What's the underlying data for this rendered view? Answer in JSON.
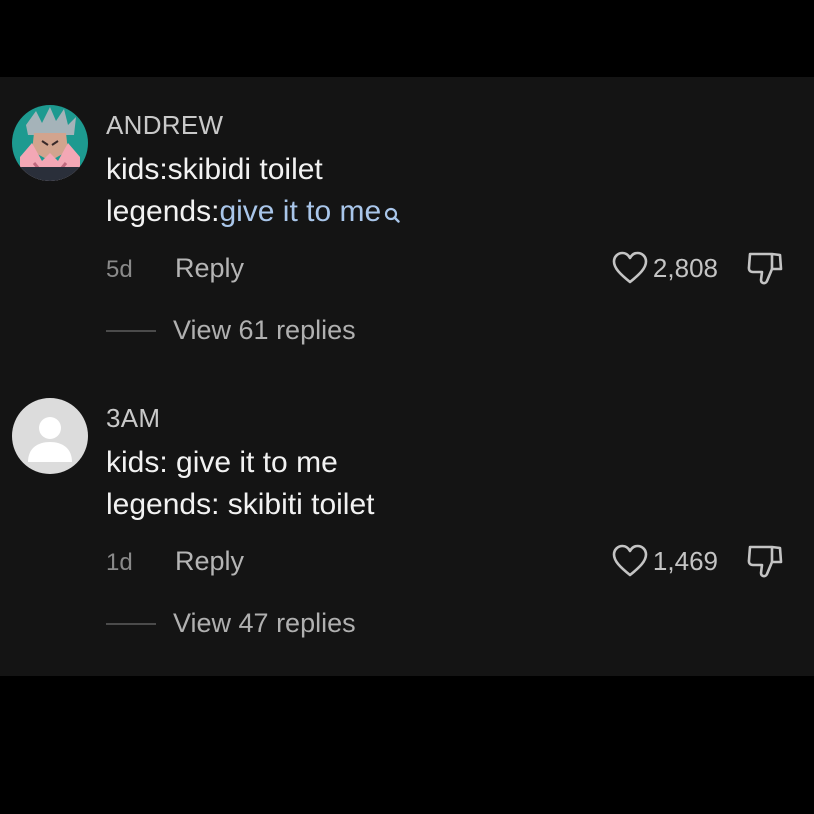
{
  "comments": [
    {
      "username": "ANDREW",
      "line1": "kids:skibidi toilet",
      "line2_prefix": "legends:",
      "line2_link": "give it to me",
      "search_icon": "search-icon",
      "timestamp": "5d",
      "reply_label": "Reply",
      "likes": "2,808",
      "view_replies": "View 61 replies",
      "avatar_icon": "anime-avatar-icon"
    },
    {
      "username": "3AM",
      "line1": "kids: give it to me",
      "line2": "legends: skibiti toilet",
      "timestamp": "1d",
      "reply_label": "Reply",
      "likes": "1,469",
      "view_replies": "View 47 replies",
      "avatar_icon": "default-user-avatar-icon"
    }
  ],
  "colors": {
    "background": "#141414",
    "letterbox": "#000000",
    "highlight": "#a9c6ea"
  }
}
